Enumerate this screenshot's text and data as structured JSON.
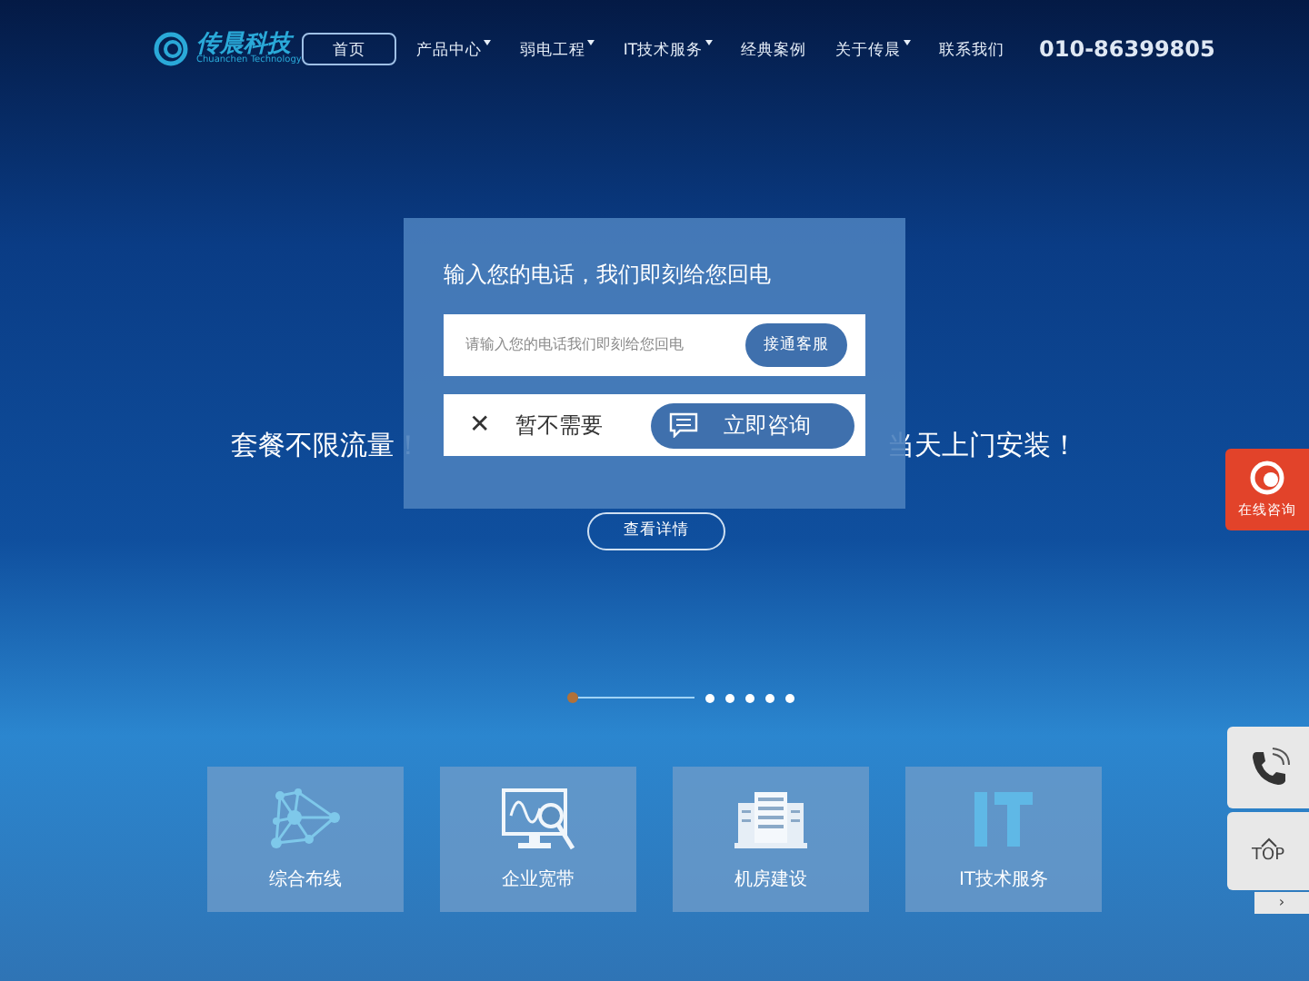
{
  "logo": {
    "name": "传晨科技",
    "subtitle": "Chuanchen Technology"
  },
  "nav": [
    {
      "label": "首页",
      "selected": true,
      "dropdown": false
    },
    {
      "label": "产品中心",
      "selected": false,
      "dropdown": true
    },
    {
      "label": "弱电工程",
      "selected": false,
      "dropdown": true
    },
    {
      "label": "IT技术服务",
      "selected": false,
      "dropdown": true
    },
    {
      "label": "经典案例",
      "selected": false,
      "dropdown": false
    },
    {
      "label": "关于传晨",
      "selected": false,
      "dropdown": true
    },
    {
      "label": "联系我们",
      "selected": false,
      "dropdown": false
    }
  ],
  "phone": "010-86399805",
  "hero": {
    "headline_left": "套餐不限流量！",
    "headline_right": "当天上门安装！",
    "button": "查看详情"
  },
  "dialog": {
    "title": "输入您的电话，我们即刻给您回电",
    "placeholder": "请输入您的电话我们即刻给您回电",
    "call_button": "接通客服",
    "close_icon": "✕",
    "dismiss": "暂不需要",
    "consult_button": "立即咨询"
  },
  "services": [
    {
      "label": "综合布线",
      "kind": "network"
    },
    {
      "label": "企业宽带",
      "kind": "monitor"
    },
    {
      "label": "机房建设",
      "kind": "server"
    },
    {
      "label": "IT技术服务",
      "kind": "it"
    }
  ],
  "side": {
    "online": "在线咨询",
    "top": "TOP",
    "collapse": "›"
  }
}
